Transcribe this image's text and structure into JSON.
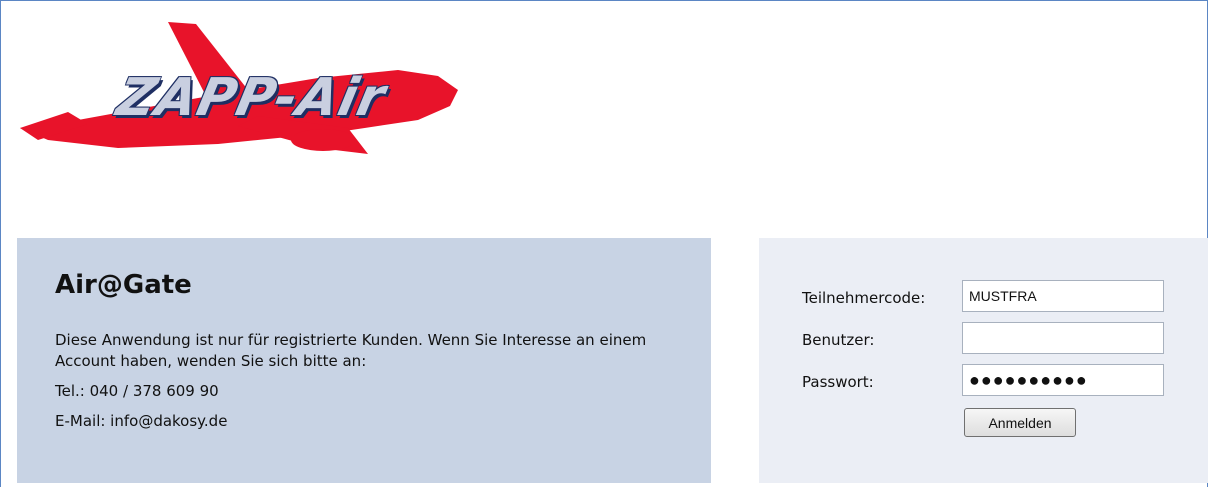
{
  "logo": {
    "text": "ZAPP-Air",
    "primary_color": "#e8132a",
    "text_color": "#c9cfe0",
    "outline_color": "#1f2f63"
  },
  "info": {
    "title": "Air@Gate",
    "description": "Diese Anwendung ist nur für registrierte Kunden. Wenn Sie Interesse an einem Account haben, wenden Sie sich bitte an:",
    "phone": "Tel.: 040 / 378 609 90",
    "email": "E-Mail: info@dakosy.de"
  },
  "login": {
    "participant_label": "Teilnehmercode:",
    "participant_value": "MUSTFRA",
    "user_label": "Benutzer:",
    "user_value": "",
    "password_label": "Passwort:",
    "password_masked": "●●●●●●●●●●",
    "submit_label": "Anmelden"
  },
  "colors": {
    "info_panel": "#c8d3e4",
    "login_panel": "#ebeef5",
    "frame_border": "#5b86c4"
  }
}
